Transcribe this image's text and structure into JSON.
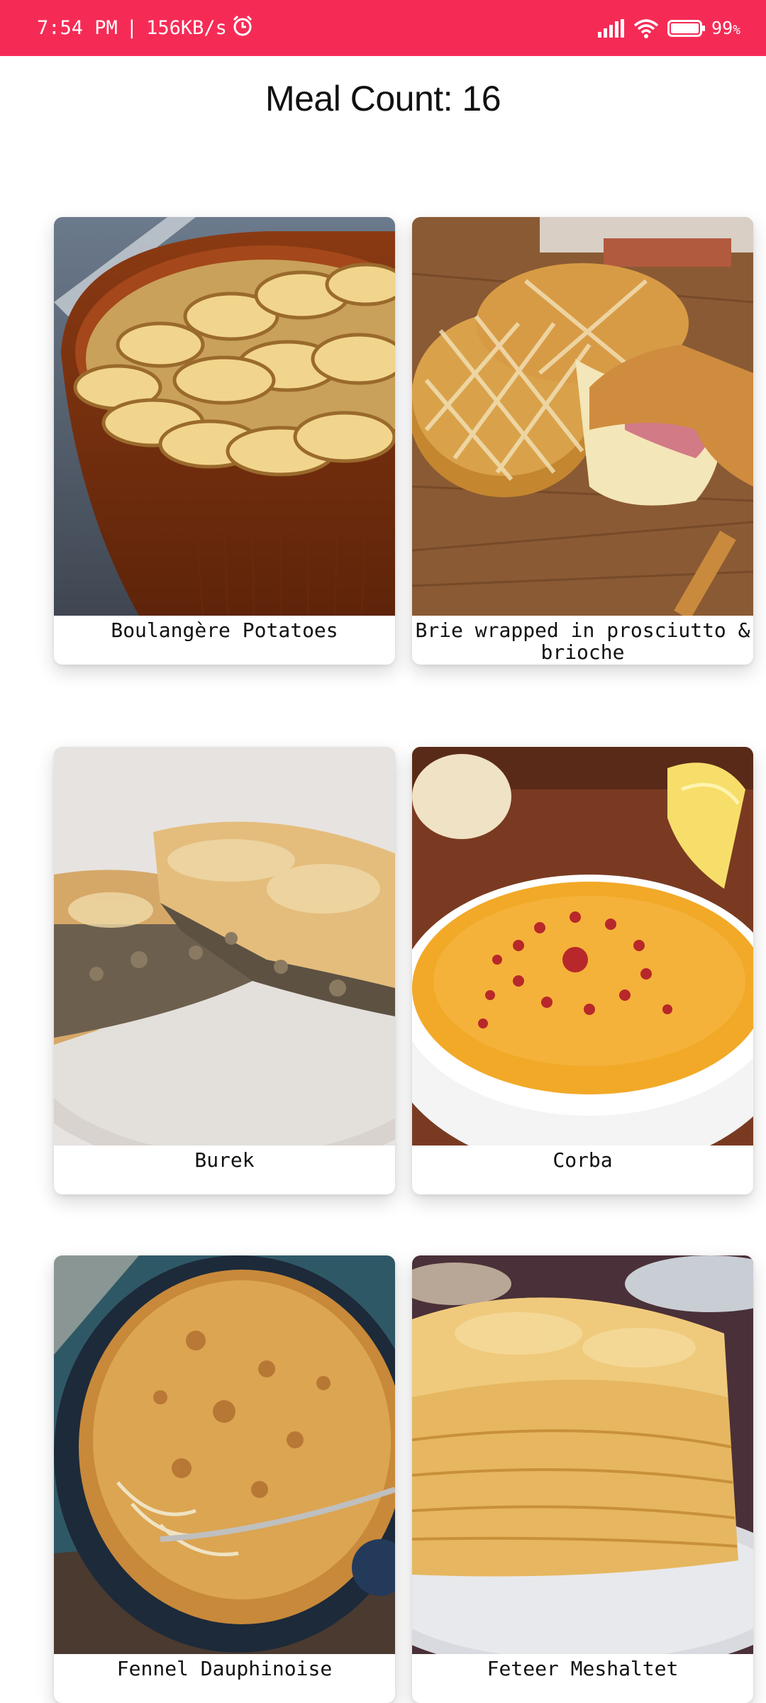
{
  "status_bar": {
    "time": "7:54 PM",
    "separator": "|",
    "speed": "156KB/s",
    "battery_text": "99",
    "icons": [
      "alarm-icon",
      "signal-icon",
      "wifi-icon",
      "battery-icon"
    ],
    "background": "#f52b56"
  },
  "header": {
    "title": "Meal Count: 16"
  },
  "meals": [
    {
      "name": "Boulangère Potatoes"
    },
    {
      "name": "Brie wrapped in prosciutto & brioche"
    },
    {
      "name": "Burek"
    },
    {
      "name": "Corba"
    },
    {
      "name": "Fennel Dauphinoise"
    },
    {
      "name": "Feteer Meshaltet"
    }
  ]
}
